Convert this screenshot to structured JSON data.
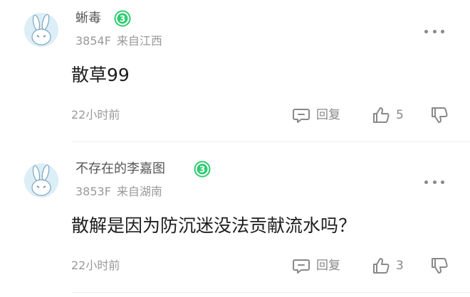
{
  "comments": [
    {
      "username": "蜥毒",
      "level": "3",
      "floor": "3854F",
      "location": "来自江西",
      "content": "散草99",
      "time": "22小时前",
      "reply_label": "回复",
      "like_count": "5"
    },
    {
      "username": "不存在的李嘉图",
      "level": "3",
      "floor": "3853F",
      "location": "来自湖南",
      "content": "散解是因为防沉迷没法贡献流水吗？",
      "time": "22小时前",
      "reply_label": "回复",
      "like_count": "3"
    }
  ],
  "colors": {
    "badge_green": "#2ecc71",
    "avatar_bg": "#dceef6",
    "muted_text": "#999999"
  },
  "icons": [
    "bunny-avatar-icon",
    "level-badge-icon",
    "more-dots-icon",
    "reply-icon",
    "thumb-up-icon",
    "thumb-down-icon"
  ]
}
